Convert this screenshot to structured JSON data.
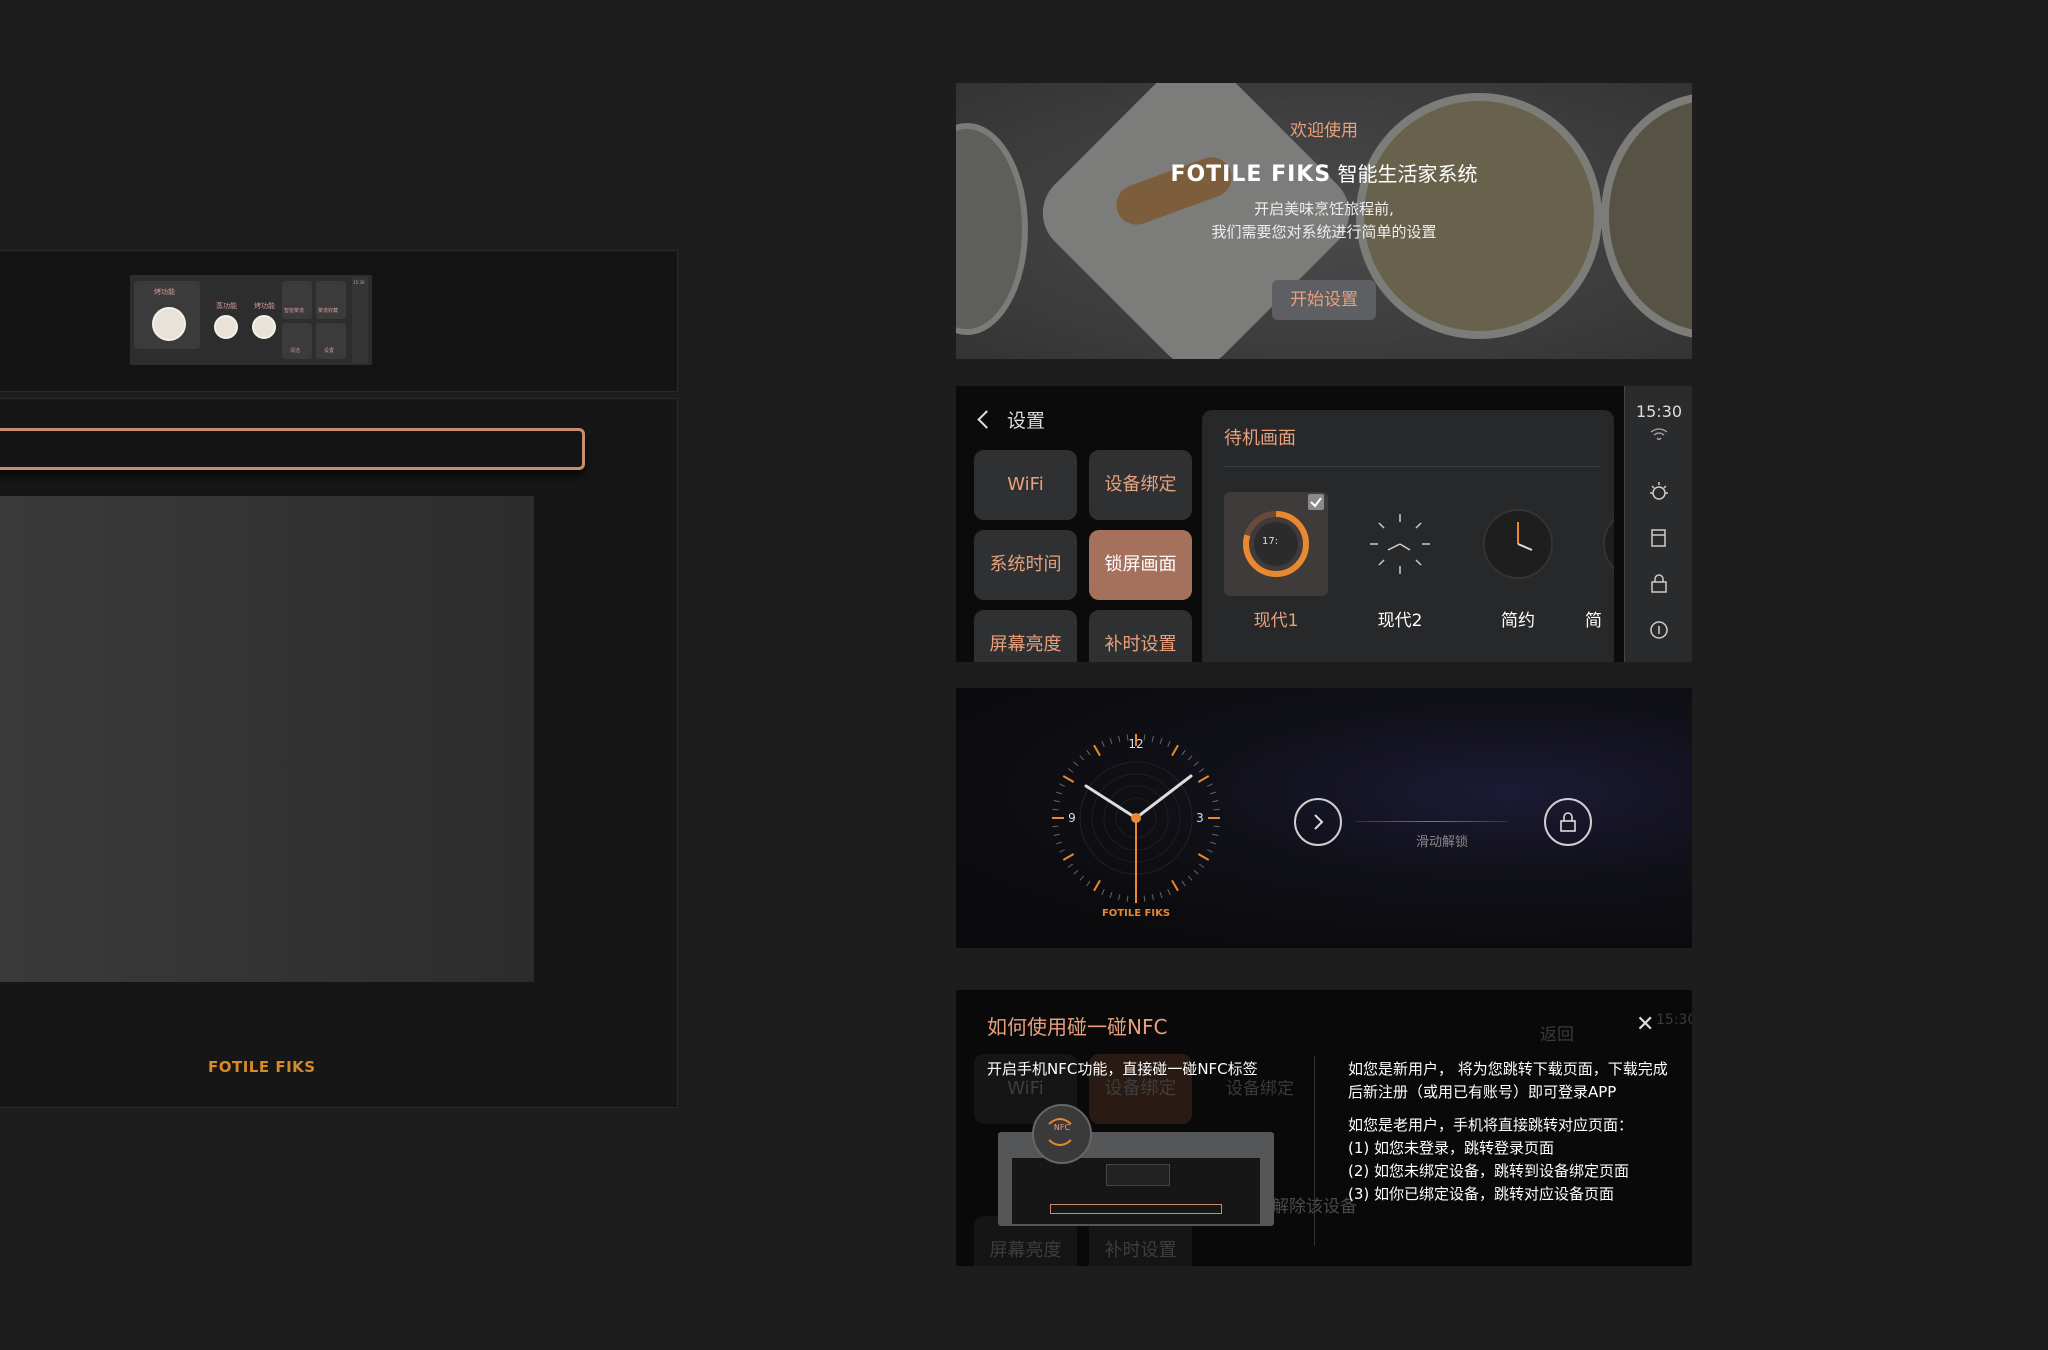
{
  "oven": {
    "logo": "FOTILE FIKS",
    "mini_screen": {
      "title": "烤功能",
      "labels": [
        "蒸功能",
        "烤功能"
      ],
      "tiles": [
        "智能菜谱",
        "菜谱收藏",
        "清洁",
        "设置"
      ],
      "time": "15:30"
    }
  },
  "welcome": {
    "title": "欢迎使用",
    "brand": "FOTILE FIKS",
    "system_name": "智能生活家系统",
    "desc_line1": "开启美味烹饪旅程前,",
    "desc_line2": "我们需要您对系统进行简单的设置",
    "start_button": "开始设置"
  },
  "settings": {
    "back_label": "设置",
    "menu": [
      {
        "label": "WiFi",
        "active": false
      },
      {
        "label": "设备绑定",
        "active": false
      },
      {
        "label": "系统时间",
        "active": false
      },
      {
        "label": "锁屏画面",
        "active": true
      },
      {
        "label": "屏幕亮度",
        "active": false
      },
      {
        "label": "补时设置",
        "active": false
      }
    ],
    "content_title": "待机画面",
    "clock_options": [
      {
        "label": "现代1",
        "selected": true,
        "preview_time": "17:"
      },
      {
        "label": "现代2",
        "selected": false
      },
      {
        "label": "简约",
        "selected": false
      },
      {
        "label": "简",
        "selected": false
      }
    ],
    "sidebar": {
      "time": "15:30",
      "icons": [
        "wifi-icon",
        "light-icon",
        "door-icon",
        "lock-icon",
        "info-icon"
      ]
    }
  },
  "lockscreen": {
    "clock_numbers": [
      "12",
      "3",
      "9"
    ],
    "brand": "FOTILE FIKS",
    "unlock_text": "滑动解锁"
  },
  "nfc": {
    "title": "如何使用碰一碰NFC",
    "left_desc": "开启手机NFC功能，直接碰一碰NFC标签",
    "nfc_badge": "NFC",
    "new_user_text": "如您是新用户， 将为您跳转下载页面，下载完成后新注册（或用已有账号）即可登录APP",
    "old_user_text": "如您是老用户，手机将直接跳转对应页面：",
    "cases": [
      "(1) 如您未登录，跳转登录页面",
      "(2) 如您未绑定设备，跳转到设备绑定页面",
      "(3) 如你已绑定设备，跳转对应设备页面"
    ],
    "background": {
      "back_label": "返回",
      "time": "15:30",
      "buttons": [
        "WiFi",
        "设备绑定",
        "屏幕亮度",
        "补时设置"
      ],
      "unbind_text": "解除该设备",
      "bind_text": "设备绑定"
    }
  },
  "colors": {
    "accent": "#e8a07d",
    "active_button": "#a6715c",
    "brand_orange": "#d98a23"
  }
}
